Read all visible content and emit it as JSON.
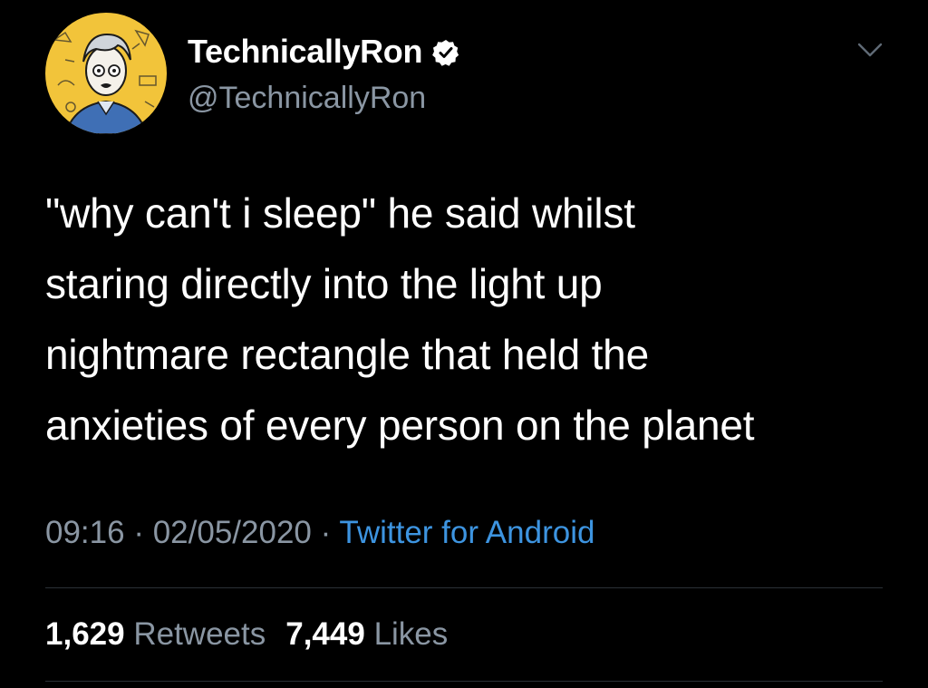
{
  "user": {
    "display_name": "TechnicallyRon",
    "handle": "@TechnicallyRon",
    "verified_icon": "verified-badge-icon",
    "avatar_icon": "cartoon-avatar"
  },
  "menu": {
    "icon": "chevron-down-icon"
  },
  "tweet": {
    "lines": [
      "\"why can't i sleep\" he said whilst",
      "staring directly into the light up",
      "nightmare rectangle that held the",
      "anxieties of every person on the planet"
    ]
  },
  "meta": {
    "time": "09:16",
    "separator": "·",
    "date": "02/05/2020",
    "source": "Twitter for Android"
  },
  "stats": {
    "retweets_count": "1,629",
    "retweets_label": "Retweets",
    "likes_count": "7,449",
    "likes_label": "Likes"
  },
  "colors": {
    "background": "#000000",
    "text": "#ffffff",
    "muted": "#8a96a3",
    "link": "#3d94e0",
    "avatar_bg": "#f2c43a"
  }
}
